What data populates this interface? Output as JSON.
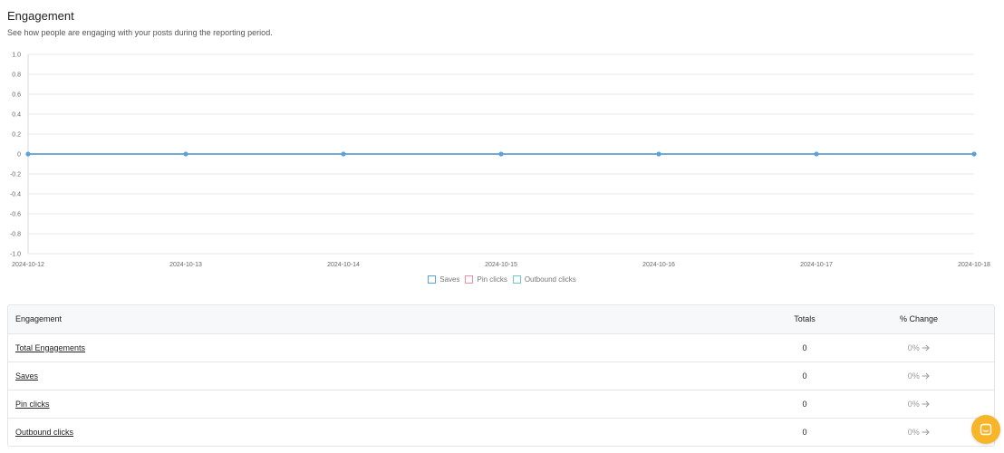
{
  "header": {
    "title": "Engagement",
    "subtitle": "See how people are engaging with your posts during the reporting period."
  },
  "chart_data": {
    "type": "line",
    "x": [
      "2024-10-12",
      "2024-10-13",
      "2024-10-14",
      "2024-10-15",
      "2024-10-16",
      "2024-10-17",
      "2024-10-18"
    ],
    "y_ticks": [
      "1.0",
      "0.8",
      "0.6",
      "0.4",
      "0.2",
      "0",
      "-0.2",
      "-0.4",
      "-0.6",
      "-0.8",
      "-1.0"
    ],
    "ylim": [
      -1.0,
      1.0
    ],
    "grid": true,
    "series": [
      {
        "name": "Saves",
        "values": [
          0,
          0,
          0,
          0,
          0,
          0,
          0
        ],
        "color": "#5aa2d9"
      },
      {
        "name": "Pin clicks",
        "values": [
          0,
          0,
          0,
          0,
          0,
          0,
          0
        ],
        "color": "#f28ca0"
      },
      {
        "name": "Outbound clicks",
        "values": [
          0,
          0,
          0,
          0,
          0,
          0,
          0
        ],
        "color": "#6fc9cc"
      }
    ],
    "legend_position": "bottom"
  },
  "table": {
    "headers": {
      "name": "Engagement",
      "totals": "Totals",
      "change": "% Change"
    },
    "rows": [
      {
        "name": "Total Engagements",
        "total": "0",
        "change": "0%"
      },
      {
        "name": "Saves",
        "total": "0",
        "change": "0%"
      },
      {
        "name": "Pin clicks",
        "total": "0",
        "change": "0%"
      },
      {
        "name": "Outbound clicks",
        "total": "0",
        "change": "0%"
      }
    ],
    "change_icon": "arrow-right-icon"
  },
  "chat_button": {
    "icon": "chat-bubble-icon",
    "color": "#f7b52a"
  }
}
